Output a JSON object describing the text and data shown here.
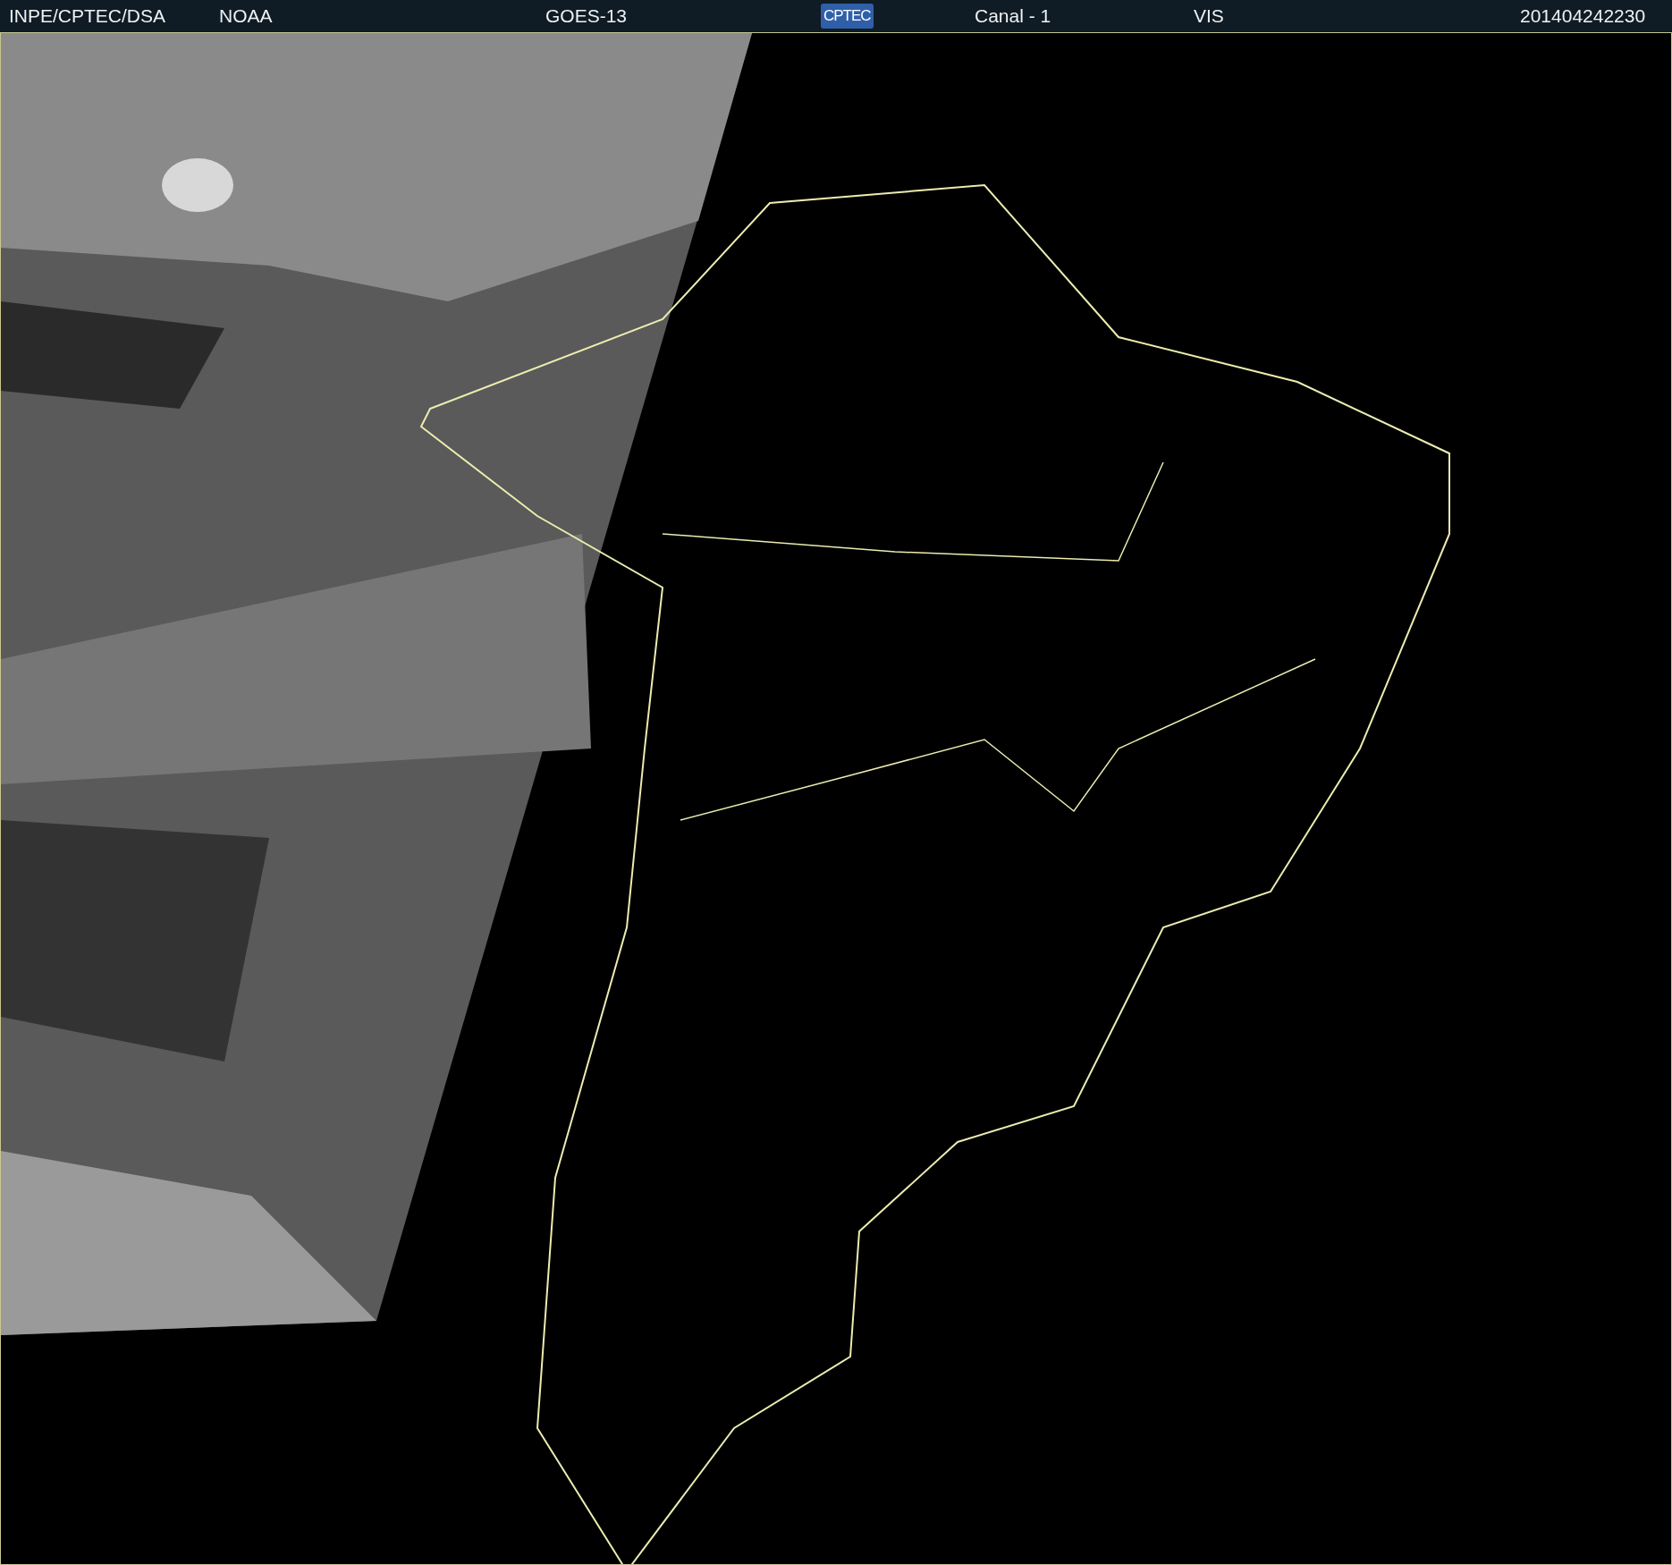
{
  "header": {
    "items": [
      {
        "kind": "text",
        "text": "INPE/CPTEC/DSA"
      },
      {
        "kind": "text",
        "text": "NOAA"
      },
      {
        "kind": "text",
        "text": "GOES-13"
      },
      {
        "kind": "logo",
        "text": "CPTEC"
      },
      {
        "kind": "text",
        "text": "Canal - 1"
      },
      {
        "kind": "text",
        "text": "VIS"
      },
      {
        "kind": "text",
        "text": "201404242230"
      }
    ]
  }
}
